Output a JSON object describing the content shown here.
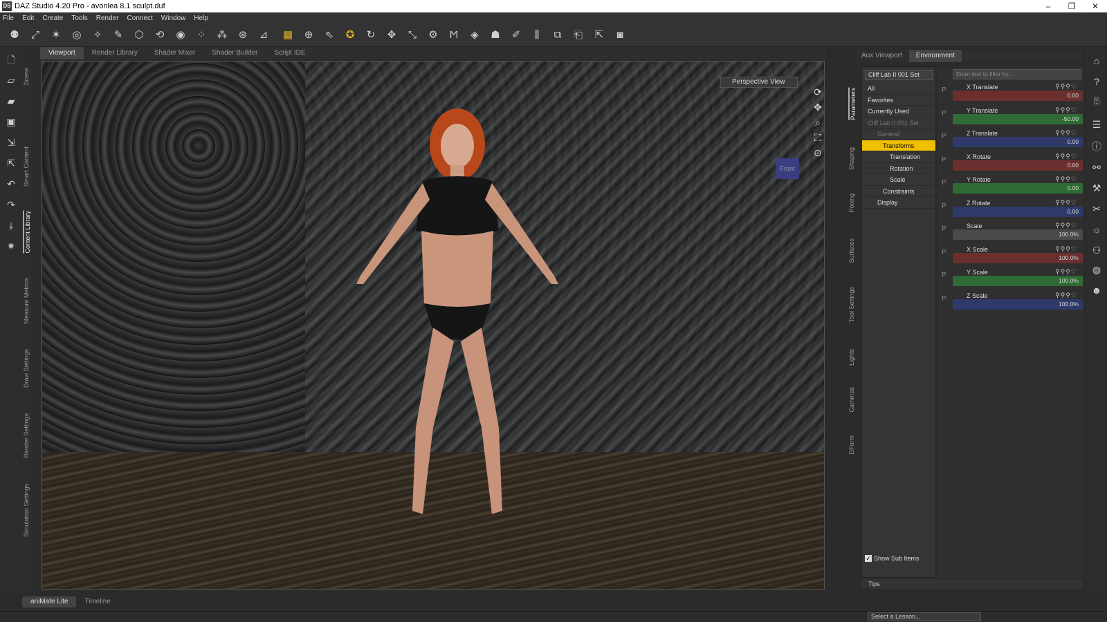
{
  "window": {
    "title": "DAZ Studio 4.20 Pro - avonlea 8.1 sculpt.duf",
    "app_icon": "DS"
  },
  "menu": [
    "File",
    "Edit",
    "Create",
    "Tools",
    "Render",
    "Connect",
    "Window",
    "Help"
  ],
  "viewport_tabs": [
    "Viewport",
    "Render Library",
    "Shader Mixer",
    "Shader Builder",
    "Script IDE"
  ],
  "viewport": {
    "view_label": "Perspective View",
    "cube_label": "Front"
  },
  "left_tabs": [
    "Scene",
    "Smart Content",
    "Content Library",
    "Measure Metrics",
    "Draw Settings",
    "Render Settings",
    "Simulation Settings"
  ],
  "right_vtabs": [
    "Parameters",
    "Shaping",
    "Posing",
    "Surfaces",
    "Tool Settings",
    "Lights",
    "Cameras",
    "DForm"
  ],
  "panel_tabs": [
    "Aux Viewport",
    "Environment"
  ],
  "tree": {
    "node_selector": "Cliff Lab II 001 Set",
    "items": [
      "All",
      "Favorites",
      "Currently Used",
      "Cliff Lab II 001 Set",
      "General",
      "Transforms",
      "Translation",
      "Rotation",
      "Scale",
      "Constraints",
      "Display"
    ],
    "show_sub_items": "Show Sub Items"
  },
  "params": {
    "filter_placeholder": "Enter text to filter by...",
    "rows": [
      {
        "label": "X Translate",
        "value": "0.00",
        "color": "#6b2f2f"
      },
      {
        "label": "Y Translate",
        "value": "-50.00",
        "color": "#2f6b35"
      },
      {
        "label": "Z Translate",
        "value": "0.00",
        "color": "#2f3a6b"
      },
      {
        "label": "X Rotate",
        "value": "0.00",
        "color": "#6b2f2f"
      },
      {
        "label": "Y Rotate",
        "value": "0.00",
        "color": "#2f6b35"
      },
      {
        "label": "Z Rotate",
        "value": "0.00",
        "color": "#2f3a6b"
      },
      {
        "label": "Scale",
        "value": "100.0%",
        "color": "#4a4a4a"
      },
      {
        "label": "X Scale",
        "value": "100.0%",
        "color": "#6b2f2f"
      },
      {
        "label": "Y Scale",
        "value": "100.0%",
        "color": "#2f6b35"
      },
      {
        "label": "Z Scale",
        "value": "100.0%",
        "color": "#2f3a6b"
      }
    ]
  },
  "tips": "Tips",
  "bottom_tabs": [
    "aniMate Lite",
    "Timeline"
  ],
  "lesson": "Select a Lesson..."
}
